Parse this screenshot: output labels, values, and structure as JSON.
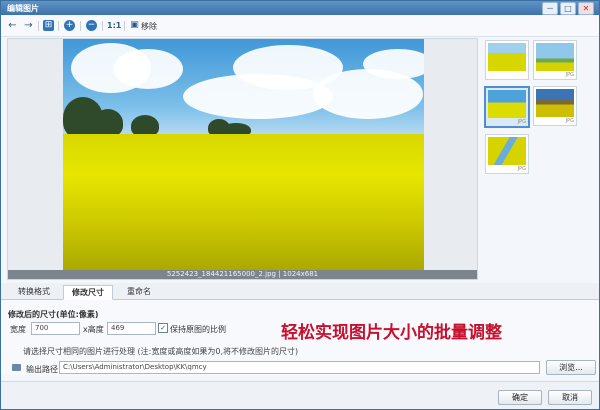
{
  "window": {
    "title": "编辑图片",
    "minimize": "－",
    "maximize": "□",
    "close": "✕"
  },
  "toolbar": {
    "back_icon": "←",
    "forward_icon": "→",
    "zoom_fit_icon": "⊞",
    "zoom_in_icon": "+",
    "zoom_out_icon": "−",
    "actual_size": "1:1",
    "move_label": "移除"
  },
  "viewer": {
    "caption": "5252423_184421165000_2.jpg | 1024x681"
  },
  "thumbnails": [
    {
      "tag": ""
    },
    {
      "tag": "JPG"
    },
    {
      "tag": "JPG"
    },
    {
      "tag": "JPG"
    },
    {
      "tag": "JPG"
    }
  ],
  "tabs": [
    {
      "label": "转换格式"
    },
    {
      "label": "修改尺寸"
    },
    {
      "label": "重命名"
    }
  ],
  "resize": {
    "section_title": "修改后的尺寸(单位:像素)",
    "width_label": "宽度",
    "width_value": "700",
    "height_label": "x高度",
    "height_value": "469",
    "keep_ratio_label": "保持原图的比例",
    "keep_ratio_checked": "✓",
    "hint": "请选择尺寸相同的图片进行处理 (注:宽度或高度如果为0,将不修改图片的尺寸)"
  },
  "output": {
    "label": "输出路径",
    "path": "C:\\Users\\Administrator\\Desktop\\KK\\qmcy",
    "browse": "浏览..."
  },
  "headline": "轻松实现图片大小的批量调整",
  "footer": {
    "ok": "确定",
    "cancel": "取消"
  }
}
